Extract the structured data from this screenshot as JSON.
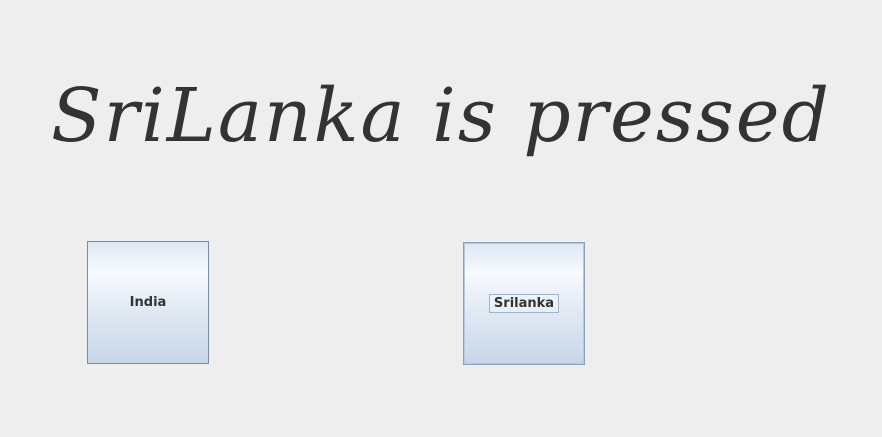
{
  "message": "SriLanka is pressed",
  "buttons": {
    "india": {
      "label": "India"
    },
    "srilanka": {
      "label": "Srilanka",
      "focused": true
    }
  },
  "colors": {
    "background": "#eeeeee",
    "text": "#333333",
    "button_border": "#7a8aa3"
  }
}
